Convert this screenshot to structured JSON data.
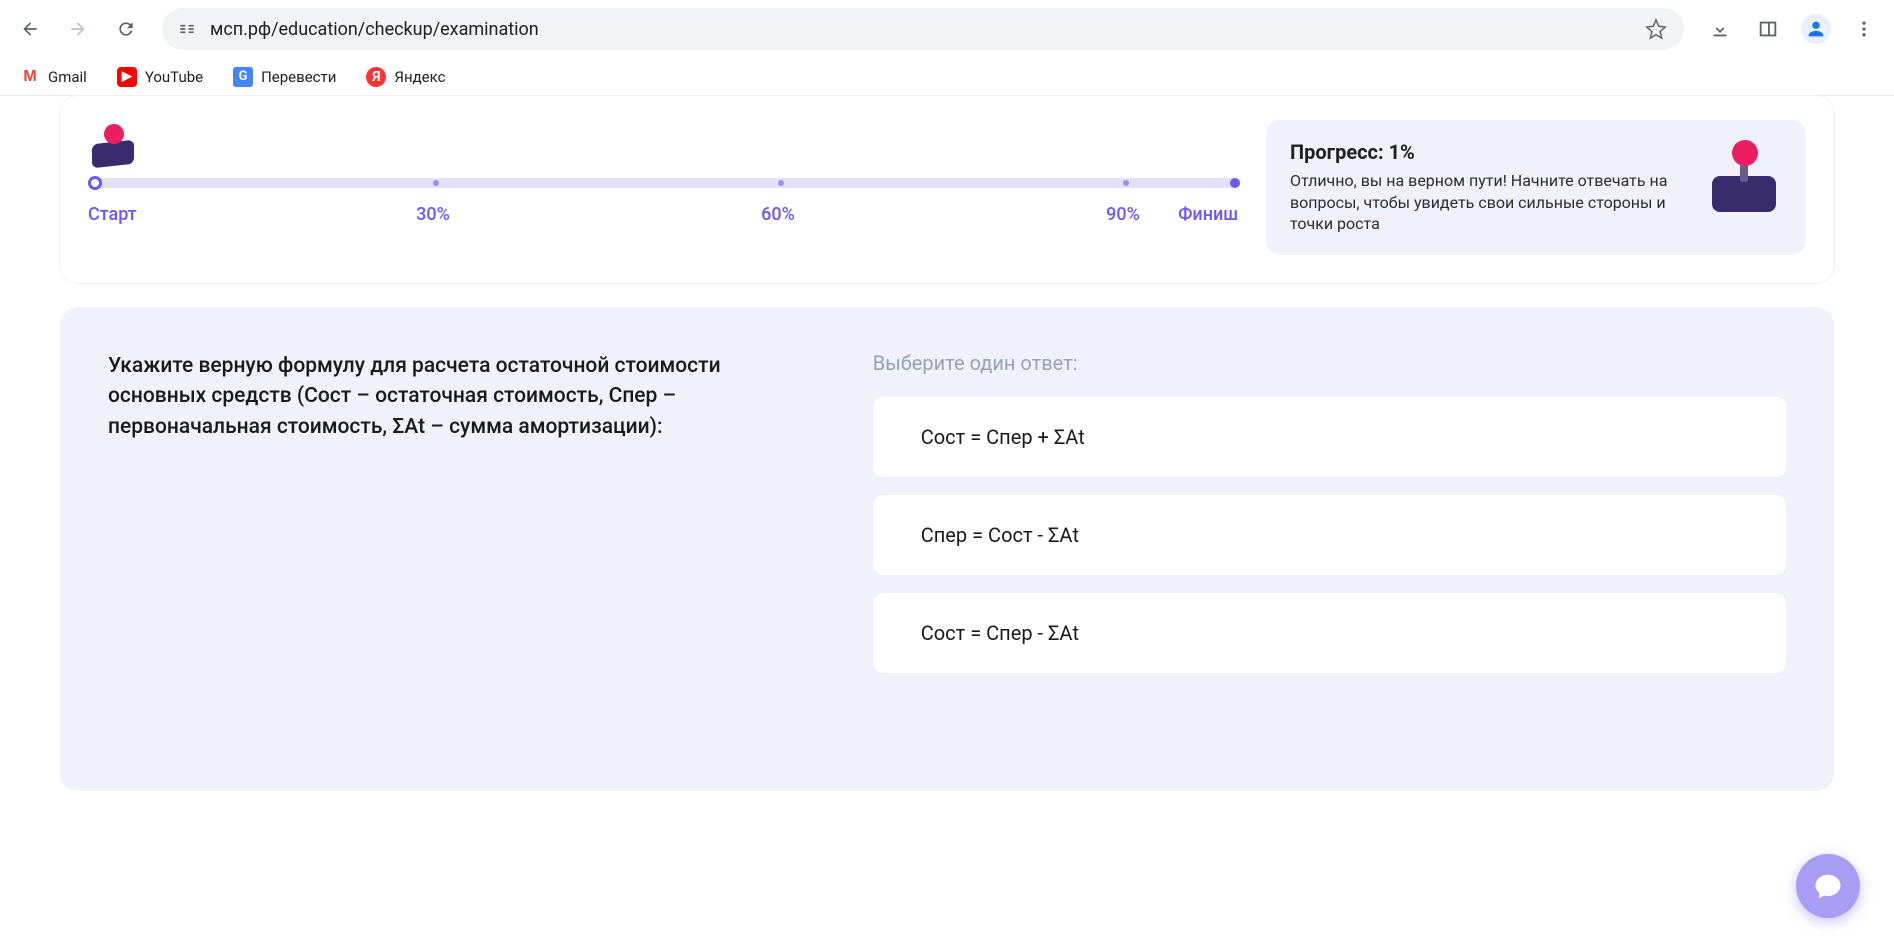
{
  "browser": {
    "url": "мсп.рф/education/checkup/examination",
    "bookmarks": [
      {
        "label": "Gmail",
        "icon": "M"
      },
      {
        "label": "YouTube",
        "icon": "▶"
      },
      {
        "label": "Перевести",
        "icon": "G"
      },
      {
        "label": "Яндекс",
        "icon": "Я"
      }
    ]
  },
  "progress": {
    "labels": {
      "start": "Старт",
      "p30": "30%",
      "p60": "60%",
      "p90": "90%",
      "finish": "Финиш"
    },
    "box": {
      "title": "Прогресс: 1%",
      "desc": "Отлично, вы на верном пути! Начните отвечать на вопросы, чтобы увидеть свои сильные стороны и точки роста"
    }
  },
  "question": {
    "text": "Укажите верную формулу для расчета остаточной стоимости основных средств (Сост – остаточная стоимость, Спер – первоначальная стоимость, ΣАt – сумма амортизации):",
    "instruction": "Выберите один ответ:",
    "options": [
      "Сост = Спер + ΣАt",
      "Спер = Сост - ΣАt",
      "Сост = Спер - ΣАt"
    ]
  }
}
